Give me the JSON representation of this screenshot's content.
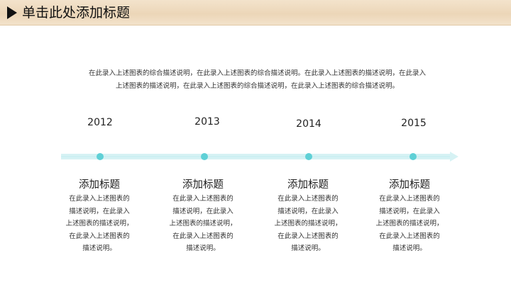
{
  "header": {
    "title": "单击此处添加标题",
    "bg_color": "#efdcc2",
    "arrow_icon": "play-triangle-icon"
  },
  "intro": {
    "line1": "在此录入上述图表的综合描述说明，在此录入上述图表的综合描述说明。在此录入上述图表的描述说明，在此录入",
    "line2": "上述图表的描述说明，在此录入上述图表的综合描述说明，在此录入上述图表的综合描述说明。"
  },
  "timeline": {
    "accent_color": "#5fd0d6",
    "line_color": "#d6f2f4",
    "items": [
      {
        "year": "2012",
        "title": "添加标题",
        "desc": [
          "在此录入上述图表的",
          "描述说明，在此录入",
          "上述图表的描述说明，",
          "在此录入上述图表的",
          "描述说明。"
        ]
      },
      {
        "year": "2013",
        "title": "添加标题",
        "desc": [
          "在此录入上述图表的",
          "描述说明，在此录入",
          "上述图表的描述说明，",
          "在此录入上述图表的",
          "描述说明。"
        ]
      },
      {
        "year": "2014",
        "title": "添加标题",
        "desc": [
          "在此录入上述图表的",
          "描述说明，在此录入",
          "上述图表的描述说明，",
          "在此录入上述图表的",
          "描述说明。"
        ]
      },
      {
        "year": "2015",
        "title": "添加标题",
        "desc": [
          "在此录入上述图表的",
          "描述说明，在此录入",
          "上述图表的描述说明，",
          "在此录入上述图表的",
          "描述说明。"
        ]
      }
    ]
  }
}
